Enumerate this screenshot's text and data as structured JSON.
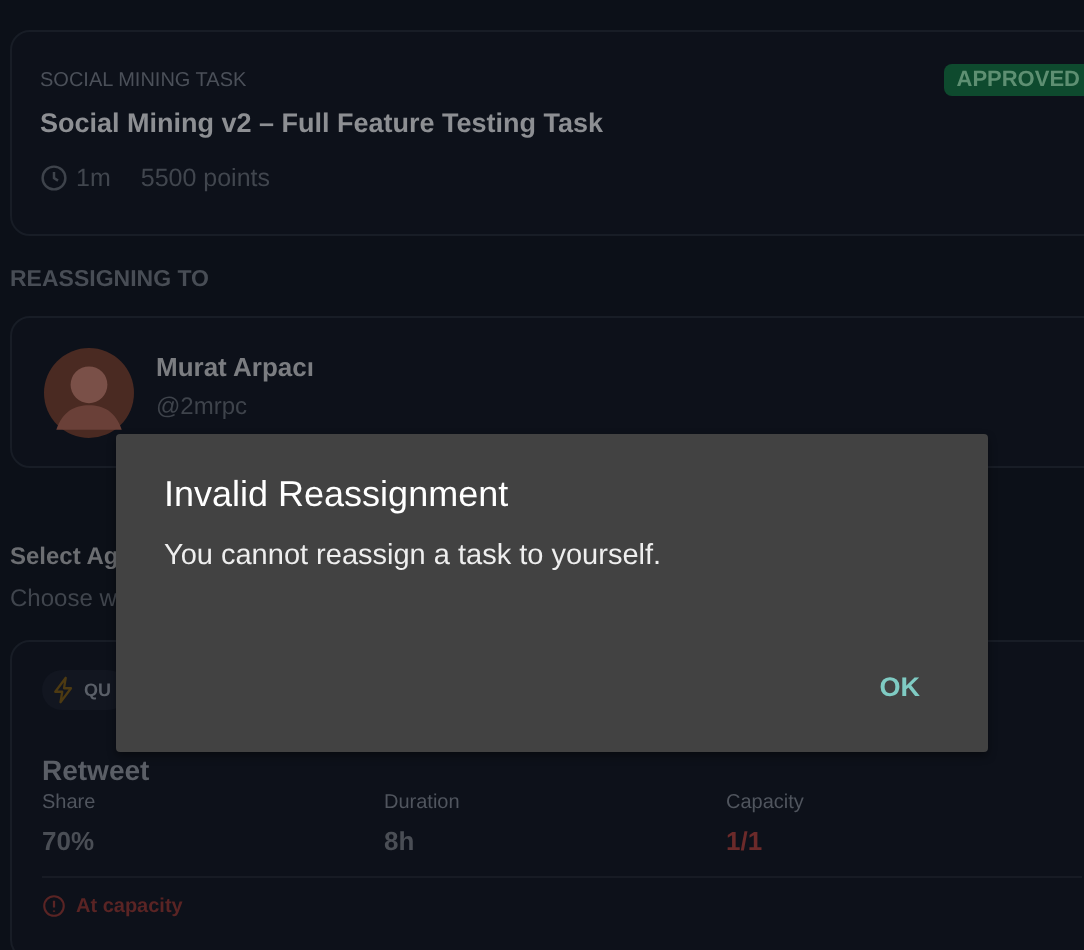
{
  "task": {
    "category": "SOCIAL MINING TASK",
    "status": "APPROVED",
    "title": "Social Mining v2 – Full Feature Testing Task",
    "duration": "1m",
    "points": "5500 points"
  },
  "reassigning": {
    "heading": "REASSIGNING TO",
    "user": {
      "name": "Murat Arpacı",
      "handle": "@2mrpc"
    }
  },
  "select_agent": {
    "heading": "Select Ag",
    "subtitle": "Choose w"
  },
  "agent_card": {
    "badge": "QU",
    "name": "Retweet",
    "stats": [
      {
        "label": "Share",
        "value": "70%",
        "kind": "normal"
      },
      {
        "label": "Duration",
        "value": "8h",
        "kind": "normal"
      },
      {
        "label": "Capacity",
        "value": "1/1",
        "kind": "warning"
      }
    ],
    "warning": "At capacity"
  },
  "dialog": {
    "title": "Invalid Reassignment",
    "message": "You cannot reassign a task to yourself.",
    "buttons": [
      "OK"
    ]
  }
}
